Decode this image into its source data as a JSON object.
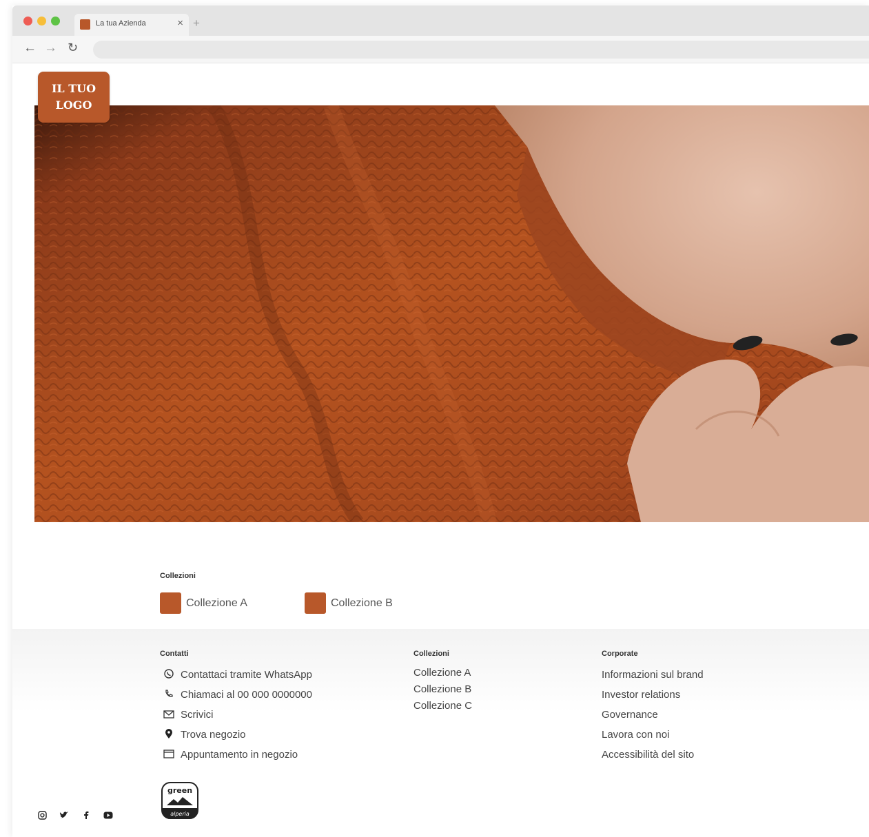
{
  "browser": {
    "tab_title": "La tua Azienda",
    "tab_close": "×",
    "new_tab": "+",
    "nav": {
      "back": "←",
      "forward": "→",
      "reload": "↻"
    }
  },
  "header": {
    "logo_line1": "IL TUO",
    "logo_line2": "LOGO"
  },
  "collections_strip": {
    "label": "Collezioni",
    "items": [
      {
        "label": "Collezione A",
        "color": "#b8582a"
      },
      {
        "label": "Collezione B",
        "color": "#b8582a"
      }
    ]
  },
  "footer": {
    "contacts": {
      "heading": "Contatti",
      "items": [
        {
          "icon": "whatsapp-icon",
          "glyph": "◯",
          "label": "Contattaci tramite WhatsApp"
        },
        {
          "icon": "phone-icon",
          "glyph": "✆",
          "label": "Chiamaci al 00 000 0000000"
        },
        {
          "icon": "mail-icon",
          "glyph": "✉",
          "label": "Scrivici"
        },
        {
          "icon": "location-pin-icon",
          "glyph": "●",
          "label": "Trova negozio"
        },
        {
          "icon": "calendar-icon",
          "glyph": "▭",
          "label": "Appuntamento in negozio"
        }
      ]
    },
    "collections": {
      "heading": "Collezioni",
      "items": [
        "Collezione A",
        "Collezione B",
        "Collezione C"
      ]
    },
    "corporate": {
      "heading": "Corporate",
      "items": [
        "Informazioni sul brand",
        "Investor relations",
        "Governance",
        "Lavora con noi",
        "Accessibilità del sito"
      ]
    },
    "badge": {
      "line1": "green",
      "line2": "alperia"
    },
    "social": [
      "instagram-icon",
      "twitter-icon",
      "facebook-icon",
      "youtube-icon"
    ]
  },
  "colors": {
    "accent": "#b8582a"
  }
}
